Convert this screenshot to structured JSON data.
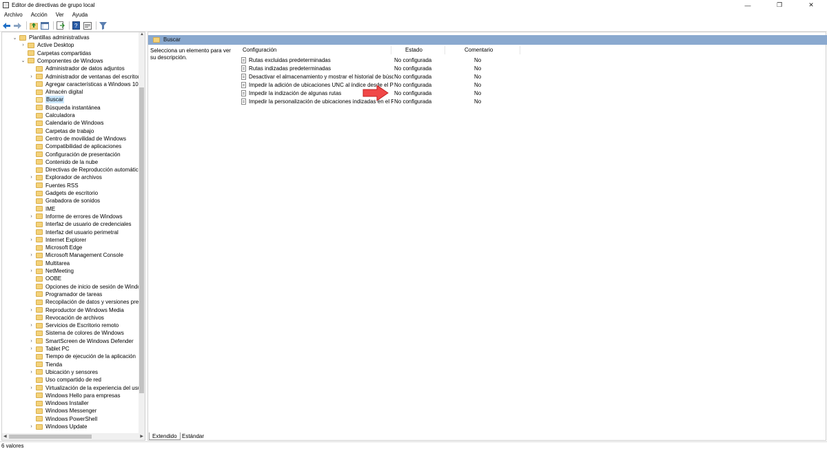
{
  "window": {
    "title": "Editor de directivas de grupo local",
    "controls": [
      "—",
      "❐",
      "✕"
    ]
  },
  "menu": [
    "Archivo",
    "Acción",
    "Ver",
    "Ayuda"
  ],
  "toolbar": {
    "icons": [
      "back-icon",
      "forward-icon",
      "up-folder-icon",
      "show-hide-tree-icon",
      "export-list-icon",
      "help-icon",
      "properties-icon",
      "filter-icon"
    ]
  },
  "tree": {
    "items": [
      {
        "label": "Plantillas administrativas",
        "expander": "v",
        "level": 0
      },
      {
        "label": "Active Desktop",
        "expander": ">",
        "level": 1
      },
      {
        "label": "Carpetas compartidas",
        "expander": "",
        "level": 1
      },
      {
        "label": "Componentes de Windows",
        "expander": "v",
        "level": 1
      },
      {
        "label": "Administrador de datos adjuntos",
        "expander": "",
        "level": 2
      },
      {
        "label": "Administrador de ventanas del escritorio",
        "expander": ">",
        "level": 2
      },
      {
        "label": "Agregar características a Windows 10",
        "expander": "",
        "level": 2
      },
      {
        "label": "Almacén digital",
        "expander": "",
        "level": 2
      },
      {
        "label": "Buscar",
        "expander": "",
        "level": 2,
        "selected": true
      },
      {
        "label": "Búsqueda instantánea",
        "expander": "",
        "level": 2
      },
      {
        "label": "Calculadora",
        "expander": "",
        "level": 2
      },
      {
        "label": "Calendario de Windows",
        "expander": "",
        "level": 2
      },
      {
        "label": "Carpetas de trabajo",
        "expander": "",
        "level": 2
      },
      {
        "label": "Centro de movilidad de Windows",
        "expander": "",
        "level": 2
      },
      {
        "label": "Compatibilidad de aplicaciones",
        "expander": "",
        "level": 2
      },
      {
        "label": "Configuración de presentación",
        "expander": "",
        "level": 2
      },
      {
        "label": "Contenido de la nube",
        "expander": "",
        "level": 2
      },
      {
        "label": "Directivas de Reproducción automática",
        "expander": "",
        "level": 2
      },
      {
        "label": "Explorador de archivos",
        "expander": ">",
        "level": 2
      },
      {
        "label": "Fuentes RSS",
        "expander": "",
        "level": 2
      },
      {
        "label": "Gadgets de escritorio",
        "expander": "",
        "level": 2
      },
      {
        "label": "Grabadora de sonidos",
        "expander": "",
        "level": 2
      },
      {
        "label": "IME",
        "expander": "",
        "level": 2
      },
      {
        "label": "Informe de errores de Windows",
        "expander": ">",
        "level": 2
      },
      {
        "label": "Interfaz de usuario de credenciales",
        "expander": "",
        "level": 2
      },
      {
        "label": "Interfaz del usuario perimetral",
        "expander": "",
        "level": 2
      },
      {
        "label": "Internet Explorer",
        "expander": ">",
        "level": 2
      },
      {
        "label": "Microsoft Edge",
        "expander": "",
        "level": 2
      },
      {
        "label": "Microsoft Management Console",
        "expander": ">",
        "level": 2
      },
      {
        "label": "Multitarea",
        "expander": "",
        "level": 2
      },
      {
        "label": "NetMeeting",
        "expander": ">",
        "level": 2
      },
      {
        "label": "OOBE",
        "expander": "",
        "level": 2
      },
      {
        "label": "Opciones de inicio de sesión de Windows",
        "expander": "",
        "level": 2
      },
      {
        "label": "Programador de tareas",
        "expander": "",
        "level": 2
      },
      {
        "label": "Recopilación de datos y versiones preliminares",
        "expander": "",
        "level": 2
      },
      {
        "label": "Reproductor de Windows Media",
        "expander": ">",
        "level": 2
      },
      {
        "label": "Revocación de archivos",
        "expander": "",
        "level": 2
      },
      {
        "label": "Servicios de Escritorio remoto",
        "expander": ">",
        "level": 2
      },
      {
        "label": "Sistema de colores de Windows",
        "expander": "",
        "level": 2
      },
      {
        "label": "SmartScreen de Windows Defender",
        "expander": ">",
        "level": 2
      },
      {
        "label": "Tablet PC",
        "expander": ">",
        "level": 2
      },
      {
        "label": "Tiempo de ejecución de la aplicación",
        "expander": "",
        "level": 2
      },
      {
        "label": "Tienda",
        "expander": "",
        "level": 2
      },
      {
        "label": "Ubicación y sensores",
        "expander": ">",
        "level": 2
      },
      {
        "label": "Uso compartido de red",
        "expander": "",
        "level": 2
      },
      {
        "label": "Virtualización de la experiencia del usuario",
        "expander": ">",
        "level": 2
      },
      {
        "label": "Windows Hello para empresas",
        "expander": "",
        "level": 2
      },
      {
        "label": "Windows Installer",
        "expander": "",
        "level": 2
      },
      {
        "label": "Windows Messenger",
        "expander": "",
        "level": 2
      },
      {
        "label": "Windows PowerShell",
        "expander": "",
        "level": 2
      },
      {
        "label": "Windows Update",
        "expander": ">",
        "level": 2
      }
    ]
  },
  "content": {
    "header_title": "Buscar",
    "description": "Selecciona un elemento para ver su descripción.",
    "columns": {
      "config": "Configuración",
      "state": "Estado",
      "comment": "Comentario"
    },
    "rows": [
      {
        "name": "Rutas excluidas predeterminadas",
        "state": "No configurada",
        "comment": "No"
      },
      {
        "name": "Rutas indizadas predeterminadas",
        "state": "No configurada",
        "comment": "No"
      },
      {
        "name": "Desactivar el almacenamiento y mostrar el historial de búsqueda",
        "state": "No configurada",
        "comment": "No"
      },
      {
        "name": "Impedir la adición de ubicaciones UNC al índice desde el Panel de control",
        "state": "No configurada",
        "comment": "No"
      },
      {
        "name": "Impedir la indización de algunas rutas",
        "state": "No configurada",
        "comment": "No"
      },
      {
        "name": "Impedir la personalización de ubicaciones indizadas en el Panel de control",
        "state": "No configurada",
        "comment": "No"
      }
    ]
  },
  "tabs": [
    "Extendido",
    "Estándar"
  ],
  "status": "6 valores",
  "colors": {
    "header_band": "#8aa9cf",
    "arrow": "#f04848",
    "selection": "#cce8ff",
    "folder": "#f4d27a"
  }
}
